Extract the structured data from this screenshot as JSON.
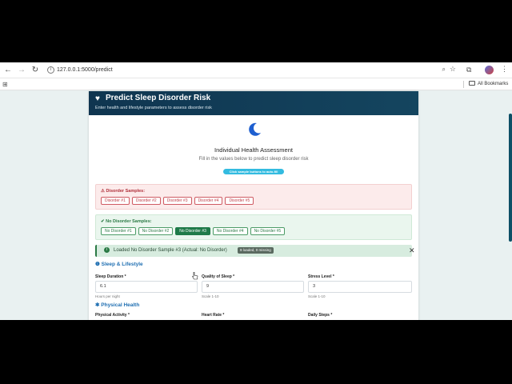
{
  "browser": {
    "url": "127.0.0.1:5000/predict",
    "all_bookmarks": "All Bookmarks"
  },
  "header": {
    "title": "Predict Sleep Disorder Risk",
    "subtitle": "Enter health and lifestyle parameters to assess disorder risk"
  },
  "intro": {
    "title": "Individual Health Assessment",
    "subtitle": "Fill in the values below to predict sleep disorder risk",
    "autofill_hint": "Click sample buttons to auto-fill"
  },
  "disorder_samples": {
    "title": "⚠ Disorder Samples:",
    "buttons": [
      "Disorder #1",
      "Disorder #2",
      "Disorder #3",
      "Disorder #4",
      "Disorder #5"
    ]
  },
  "no_disorder_samples": {
    "title": "✔ No Disorder Samples:",
    "buttons": [
      "No Disorder #1",
      "No Disorder #2",
      "No Disorder #3",
      "No Disorder #4",
      "No Disorder #5"
    ],
    "active_index": 2
  },
  "alert": {
    "text": "Loaded No Disorder Sample #3 (Actual: No Disorder)",
    "badge": "9 loaded, 0 missing",
    "close": "✕"
  },
  "sleep_section": {
    "title": "Sleep & Lifestyle",
    "fields": [
      {
        "label": "Sleep Duration *",
        "value": "6.1",
        "hint": "Hours per night"
      },
      {
        "label": "Quality of Sleep *",
        "value": "9",
        "hint": "Scale 1-10"
      },
      {
        "label": "Stress Level *",
        "value": "3",
        "hint": "Scale 1-10"
      }
    ]
  },
  "physical_section": {
    "title": "Physical Health",
    "fields": [
      {
        "label": "Physical Activity *"
      },
      {
        "label": "Heart Rate *"
      },
      {
        "label": "Daily Steps *"
      }
    ]
  },
  "colors": {
    "header_bg": "#0f3550",
    "accent_blue": "#1f6fb2",
    "disorder_red": "#c0424b",
    "no_disorder_green": "#2b7a45",
    "autofill_cyan": "#33bbe0"
  },
  "icons": [
    "back-icon",
    "forward-icon",
    "reload-icon",
    "site-info-icon",
    "zoom-icon",
    "star-icon",
    "extensions-icon",
    "menu-icon",
    "apps-icon",
    "folder-icon",
    "heart-pulse-icon",
    "moon-icon",
    "warning-icon",
    "check-icon",
    "info-icon",
    "close-icon",
    "sleep-icon",
    "activity-icon",
    "cursor-icon"
  ]
}
